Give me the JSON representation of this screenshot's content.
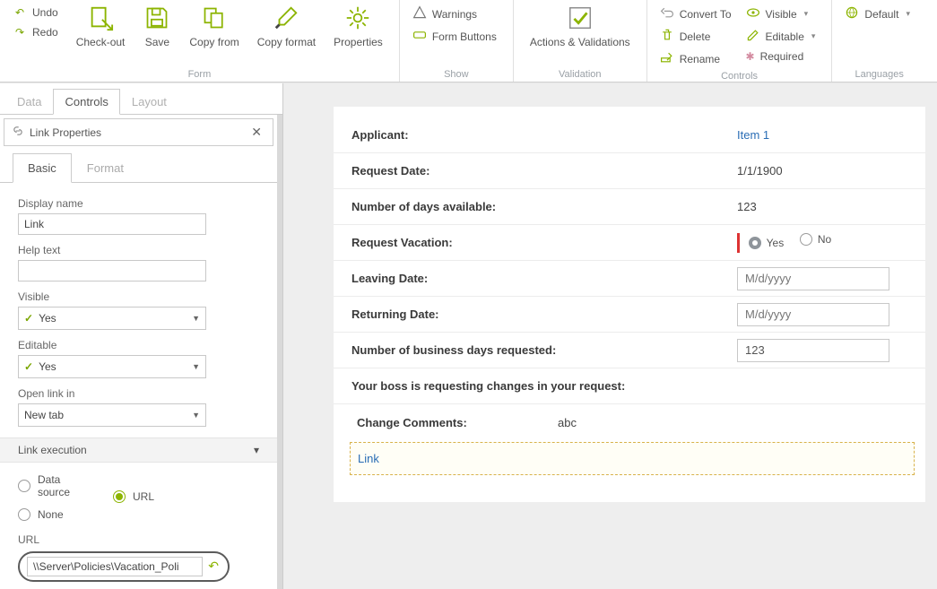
{
  "ribbon": {
    "history": {
      "undo": "Undo",
      "redo": "Redo"
    },
    "form": {
      "group": "Form",
      "checkout": "Check-out",
      "save": "Save",
      "copyfrom": "Copy from",
      "copyformat": "Copy format",
      "properties": "Properties"
    },
    "show": {
      "group": "Show",
      "warnings": "Warnings",
      "formbuttons": "Form Buttons"
    },
    "validation": {
      "group": "Validation",
      "actions": "Actions & Validations"
    },
    "controls": {
      "group": "Controls",
      "convert": "Convert To",
      "delete": "Delete",
      "rename": "Rename",
      "visible": "Visible",
      "editable": "Editable",
      "required": "Required"
    },
    "languages": {
      "group": "Languages",
      "default": "Default"
    }
  },
  "left": {
    "tabs": {
      "data": "Data",
      "controls": "Controls",
      "layout": "Layout"
    },
    "panel_title": "Link Properties",
    "subtabs": {
      "basic": "Basic",
      "format": "Format"
    },
    "display_name": {
      "label": "Display name",
      "value": "Link"
    },
    "help_text": {
      "label": "Help text",
      "value": ""
    },
    "visible": {
      "label": "Visible",
      "value": "Yes"
    },
    "editable": {
      "label": "Editable",
      "value": "Yes"
    },
    "open_in": {
      "label": "Open link in",
      "value": "New tab"
    },
    "link_exec": {
      "header": "Link execution",
      "options": {
        "datasource": "Data source",
        "url": "URL",
        "none": "None"
      },
      "selected": "url"
    },
    "url": {
      "label": "URL",
      "value": "\\\\Server\\Policies\\Vacation_Poli"
    }
  },
  "form": {
    "applicant": {
      "label": "Applicant:",
      "value": "Item 1"
    },
    "request_date": {
      "label": "Request Date:",
      "value": "1/1/1900"
    },
    "days_available": {
      "label": "Number of days available:",
      "value": "123"
    },
    "request_vacation": {
      "label": "Request Vacation:",
      "yes": "Yes",
      "no": "No"
    },
    "leaving": {
      "label": "Leaving Date:",
      "placeholder": "M/d/yyyy"
    },
    "returning": {
      "label": "Returning Date:",
      "placeholder": "M/d/yyyy"
    },
    "biz_days": {
      "label": "Number of business days requested:",
      "value": "123"
    },
    "boss": {
      "label": "Your boss is requesting changes in your request:"
    },
    "comments": {
      "label": "Change Comments:",
      "value": "abc"
    },
    "link": {
      "label": "Link"
    }
  }
}
